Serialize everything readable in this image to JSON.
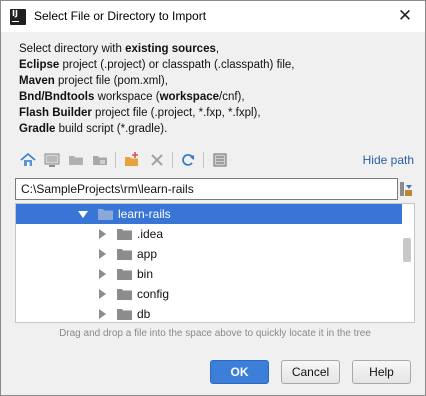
{
  "window": {
    "title": "Select File or Directory to Import",
    "close_glyph": "✕"
  },
  "description": {
    "line1": {
      "text1": "Select directory with ",
      "bold1": "existing sources",
      "text2": ","
    },
    "line2": {
      "bold1": "Eclipse",
      "text1": " project (.project) or classpath (.classpath) file,"
    },
    "line3": {
      "bold1": "Maven",
      "text1": " project file (pom.xml),"
    },
    "line4": {
      "bold1": "Bnd/Bndtools",
      "text1": " workspace (",
      "bold2": "workspace",
      "text2": "/cnf),"
    },
    "line5": {
      "bold1": "Flash Builder",
      "text1": " project file (.project, *.fxp, *.fxpl),"
    },
    "line6": {
      "bold1": "Gradle",
      "text1": " build script (*.gradle)."
    }
  },
  "toolbar": {
    "icons": [
      "home-icon",
      "desktop-icon",
      "folder-icon",
      "module-folder-icon",
      "new-folder-icon",
      "delete-icon",
      "refresh-icon",
      "show-hidden-icon"
    ],
    "hide_path_label": "Hide path"
  },
  "path_field": {
    "value": "C:\\SampleProjects\\rm\\learn-rails"
  },
  "tree": {
    "selected": "learn-rails",
    "items": [
      {
        "label": "learn-rails",
        "expanded": true
      },
      {
        "label": ".idea",
        "expanded": false
      },
      {
        "label": "app",
        "expanded": false
      },
      {
        "label": "bin",
        "expanded": false
      },
      {
        "label": "config",
        "expanded": false
      },
      {
        "label": "db",
        "expanded": false
      }
    ]
  },
  "hint": "Drag and drop a file into the space above to quickly locate it in the tree",
  "buttons": {
    "ok": "OK",
    "cancel": "Cancel",
    "help": "Help"
  },
  "colors": {
    "accent": "#3875d7",
    "link": "#2a5ea8",
    "ok_button": "#3d7fd8",
    "folder": "#8c8c8c"
  }
}
